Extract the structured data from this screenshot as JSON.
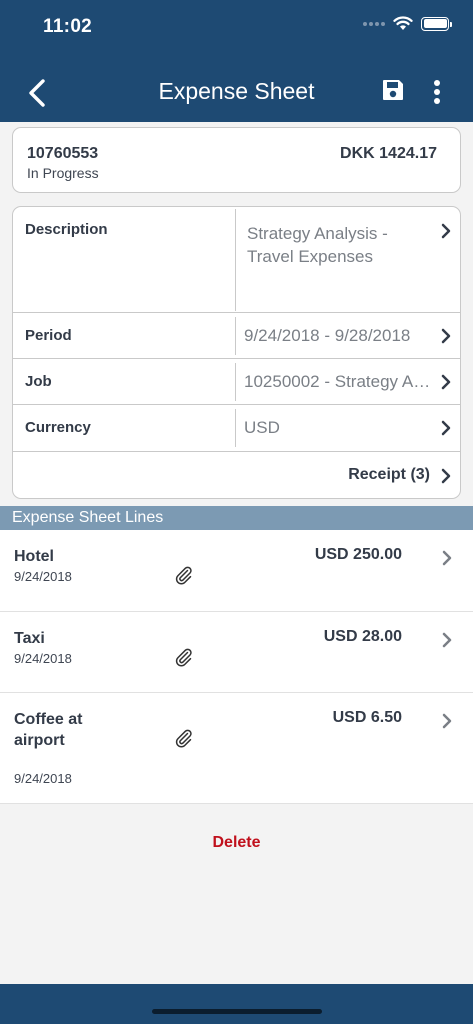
{
  "status_bar": {
    "time": "11:02"
  },
  "header": {
    "title": "Expense Sheet"
  },
  "summary": {
    "number": "10760553",
    "status": "In Progress",
    "total": "DKK 1424.17"
  },
  "details": {
    "description": {
      "label": "Description",
      "value_line1": "Strategy Analysis -",
      "value_line2": "Travel Expenses"
    },
    "period": {
      "label": "Period",
      "value": "9/24/2018 - 9/28/2018"
    },
    "job": {
      "label": "Job",
      "value": "10250002 - Strategy An..."
    },
    "currency": {
      "label": "Currency",
      "value": "USD"
    },
    "receipt": {
      "label": "Receipt (3)"
    }
  },
  "lines": {
    "title": "Expense Sheet Lines",
    "items": [
      {
        "description": "Hotel",
        "date": "9/24/2018",
        "amount": "USD 250.00"
      },
      {
        "description": "Taxi",
        "date": "9/24/2018",
        "amount": "USD 28.00"
      },
      {
        "description": "Coffee at airport",
        "date": "9/24/2018",
        "amount": "USD 6.50"
      }
    ]
  },
  "actions": {
    "delete": "Delete"
  },
  "colors": {
    "header_bg": "#1e4a73",
    "section_header_bg": "#7c9ab3",
    "delete_text": "#c0101c"
  }
}
